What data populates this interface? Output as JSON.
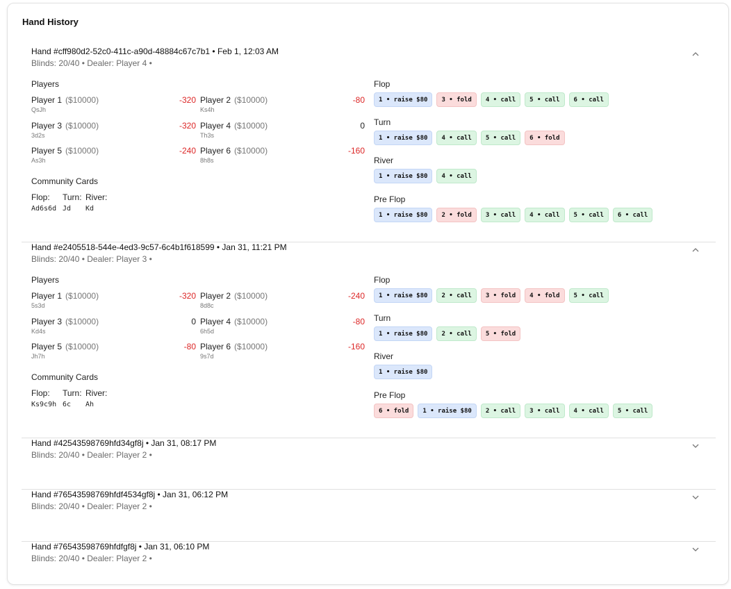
{
  "title": "Hand History",
  "labels": {
    "players": "Players",
    "community": "Community Cards",
    "flop": "Flop:",
    "turn": "Turn:",
    "river": "River:"
  },
  "colors": {
    "negative": "#dc2626",
    "raise_bg": "#dbe7fb",
    "fold_bg": "#fbdcdc",
    "call_bg": "#dcf5e2"
  },
  "icons": {
    "expanded": "chevron-up-icon",
    "collapsed": "chevron-down-icon"
  },
  "hands": [
    {
      "title": "Hand #cff980d2-52c0-411c-a90d-48884c67c7b1 • Feb 1, 12:03 AM",
      "subtitle": "Blinds: 20/40 • Dealer: Player 4 •",
      "expanded": true,
      "players": [
        {
          "name": "Player 1",
          "stack": "($10000)",
          "cards": "QsJh",
          "net": "-320"
        },
        {
          "name": "Player 2",
          "stack": "($10000)",
          "cards": "Ks4h",
          "net": "-80"
        },
        {
          "name": "Player 3",
          "stack": "($10000)",
          "cards": "3d2s",
          "net": "-320"
        },
        {
          "name": "Player 4",
          "stack": "($10000)",
          "cards": "Th3s",
          "net": "0"
        },
        {
          "name": "Player 5",
          "stack": "($10000)",
          "cards": "As3h",
          "net": "-240"
        },
        {
          "name": "Player 6",
          "stack": "($10000)",
          "cards": "8h8s",
          "net": "-160"
        }
      ],
      "community": {
        "flop": "Ad6s6d",
        "turn": "Jd",
        "river": "Kd"
      },
      "streets": [
        {
          "name": "Flop",
          "actions": [
            {
              "text": "1 • raise $80",
              "type": "raise"
            },
            {
              "text": "3 • fold",
              "type": "fold"
            },
            {
              "text": "4 • call",
              "type": "call"
            },
            {
              "text": "5 • call",
              "type": "call"
            },
            {
              "text": "6 • call",
              "type": "call"
            }
          ]
        },
        {
          "name": "Turn",
          "actions": [
            {
              "text": "1 • raise $80",
              "type": "raise"
            },
            {
              "text": "4 • call",
              "type": "call"
            },
            {
              "text": "5 • call",
              "type": "call"
            },
            {
              "text": "6 • fold",
              "type": "fold"
            }
          ]
        },
        {
          "name": "River",
          "actions": [
            {
              "text": "1 • raise $80",
              "type": "raise"
            },
            {
              "text": "4 • call",
              "type": "call"
            }
          ]
        },
        {
          "name": "Pre Flop",
          "actions": [
            {
              "text": "1 • raise $80",
              "type": "raise"
            },
            {
              "text": "2 • fold",
              "type": "fold"
            },
            {
              "text": "3 • call",
              "type": "call"
            },
            {
              "text": "4 • call",
              "type": "call"
            },
            {
              "text": "5 • call",
              "type": "call"
            },
            {
              "text": "6 • call",
              "type": "call"
            }
          ]
        }
      ]
    },
    {
      "title": "Hand #e2405518-544e-4ed3-9c57-6c4b1f618599 • Jan 31, 11:21 PM",
      "subtitle": "Blinds: 20/40 • Dealer: Player 3 •",
      "expanded": true,
      "players": [
        {
          "name": "Player 1",
          "stack": "($10000)",
          "cards": "5s3d",
          "net": "-320"
        },
        {
          "name": "Player 2",
          "stack": "($10000)",
          "cards": "8d8c",
          "net": "-240"
        },
        {
          "name": "Player 3",
          "stack": "($10000)",
          "cards": "Kd4s",
          "net": "0"
        },
        {
          "name": "Player 4",
          "stack": "($10000)",
          "cards": "6h5d",
          "net": "-80"
        },
        {
          "name": "Player 5",
          "stack": "($10000)",
          "cards": "Jh7h",
          "net": "-80"
        },
        {
          "name": "Player 6",
          "stack": "($10000)",
          "cards": "9s7d",
          "net": "-160"
        }
      ],
      "community": {
        "flop": "Ks9c9h",
        "turn": "6c",
        "river": "Ah"
      },
      "streets": [
        {
          "name": "Flop",
          "actions": [
            {
              "text": "1 • raise $80",
              "type": "raise"
            },
            {
              "text": "2 • call",
              "type": "call"
            },
            {
              "text": "3 • fold",
              "type": "fold"
            },
            {
              "text": "4 • fold",
              "type": "fold"
            },
            {
              "text": "5 • call",
              "type": "call"
            }
          ]
        },
        {
          "name": "Turn",
          "actions": [
            {
              "text": "1 • raise $80",
              "type": "raise"
            },
            {
              "text": "2 • call",
              "type": "call"
            },
            {
              "text": "5 • fold",
              "type": "fold"
            }
          ]
        },
        {
          "name": "River",
          "actions": [
            {
              "text": "1 • raise $80",
              "type": "raise"
            }
          ]
        },
        {
          "name": "Pre Flop",
          "actions": [
            {
              "text": "6 • fold",
              "type": "fold"
            },
            {
              "text": "1 • raise $80",
              "type": "raise"
            },
            {
              "text": "2 • call",
              "type": "call"
            },
            {
              "text": "3 • call",
              "type": "call"
            },
            {
              "text": "4 • call",
              "type": "call"
            },
            {
              "text": "5 • call",
              "type": "call"
            }
          ]
        }
      ]
    },
    {
      "title": "Hand #42543598769hfd34gf8j • Jan 31, 08:17 PM",
      "subtitle": "Blinds: 20/40 • Dealer: Player 2 •",
      "expanded": false
    },
    {
      "title": "Hand #76543598769hfdf4534gf8j • Jan 31, 06:12 PM",
      "subtitle": "Blinds: 20/40 • Dealer: Player 2 •",
      "expanded": false
    },
    {
      "title": "Hand #76543598769hfdfgf8j • Jan 31, 06:10 PM",
      "subtitle": "Blinds: 20/40 • Dealer: Player 2 •",
      "expanded": false
    }
  ]
}
